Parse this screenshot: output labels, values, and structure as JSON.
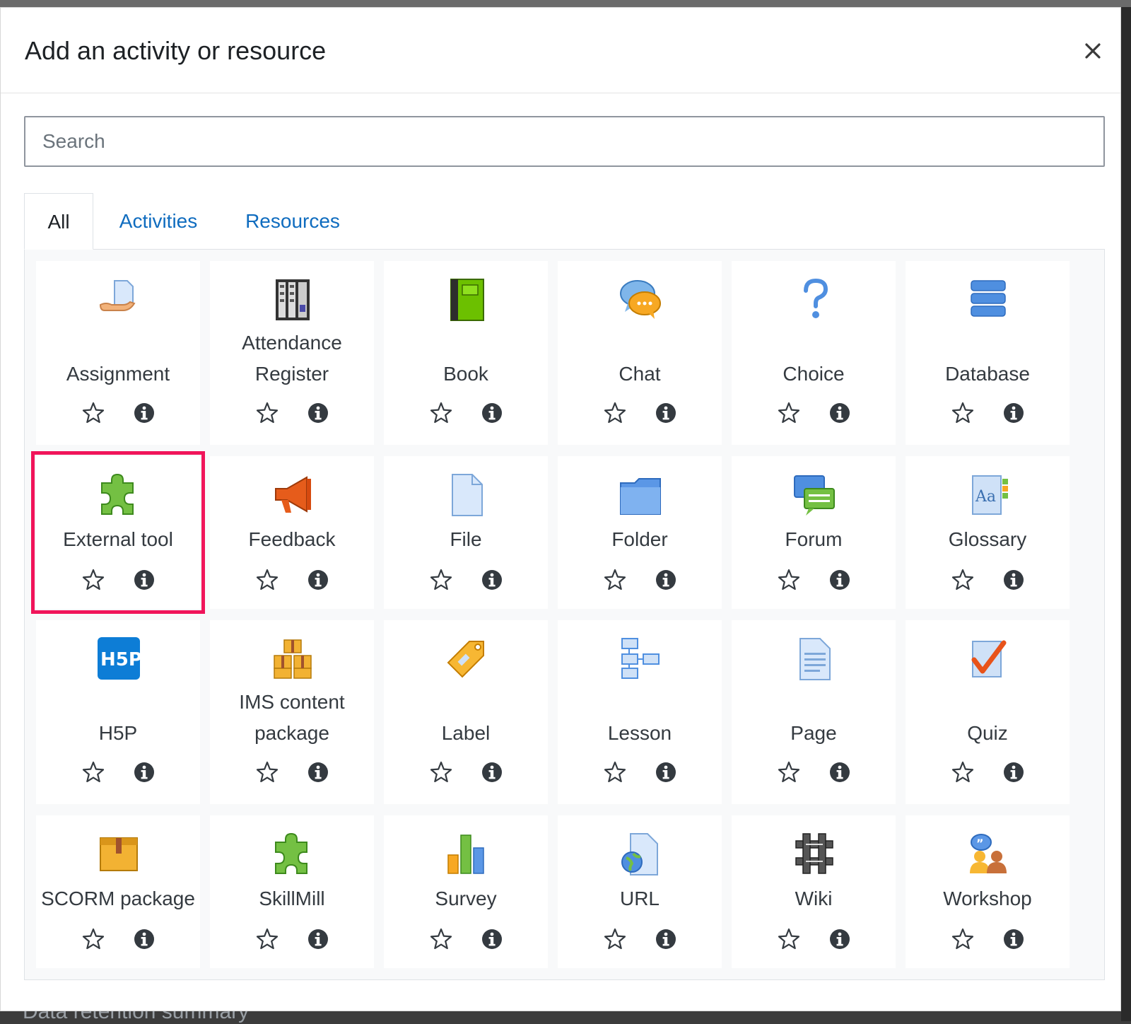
{
  "modal": {
    "title": "Add an activity or resource",
    "close_icon": "close-icon"
  },
  "search": {
    "placeholder": "Search",
    "value": ""
  },
  "tabs": [
    {
      "label": "All",
      "active": true
    },
    {
      "label": "Activities",
      "active": false
    },
    {
      "label": "Resources",
      "active": false
    }
  ],
  "modules": [
    {
      "label": "Assignment",
      "icon": "assignment-icon",
      "starred": false
    },
    {
      "label": "Attendance Register",
      "icon": "attendance-register-icon",
      "starred": false
    },
    {
      "label": "Book",
      "icon": "book-icon",
      "starred": false
    },
    {
      "label": "Chat",
      "icon": "chat-icon",
      "starred": false
    },
    {
      "label": "Choice",
      "icon": "choice-icon",
      "starred": false
    },
    {
      "label": "Database",
      "icon": "database-icon",
      "starred": false
    },
    {
      "label": "External tool",
      "icon": "external-tool-icon",
      "starred": false,
      "highlighted": true
    },
    {
      "label": "Feedback",
      "icon": "feedback-icon",
      "starred": false
    },
    {
      "label": "File",
      "icon": "file-icon",
      "starred": false
    },
    {
      "label": "Folder",
      "icon": "folder-icon",
      "starred": false
    },
    {
      "label": "Forum",
      "icon": "forum-icon",
      "starred": false
    },
    {
      "label": "Glossary",
      "icon": "glossary-icon",
      "starred": false
    },
    {
      "label": "H5P",
      "icon": "h5p-icon",
      "starred": false
    },
    {
      "label": "IMS content package",
      "icon": "ims-content-package-icon",
      "starred": false
    },
    {
      "label": "Label",
      "icon": "label-icon",
      "starred": false
    },
    {
      "label": "Lesson",
      "icon": "lesson-icon",
      "starred": false
    },
    {
      "label": "Page",
      "icon": "page-icon",
      "starred": false
    },
    {
      "label": "Quiz",
      "icon": "quiz-icon",
      "starred": false
    },
    {
      "label": "SCORM package",
      "icon": "scorm-package-icon",
      "starred": false
    },
    {
      "label": "SkillMill",
      "icon": "skillmill-icon",
      "starred": false
    },
    {
      "label": "Survey",
      "icon": "survey-icon",
      "starred": false
    },
    {
      "label": "URL",
      "icon": "url-icon",
      "starred": false
    },
    {
      "label": "Wiki",
      "icon": "wiki-icon",
      "starred": false
    },
    {
      "label": "Workshop",
      "icon": "workshop-icon",
      "starred": false
    }
  ],
  "icons": {
    "star": "star-outline-icon",
    "info": "info-icon"
  },
  "colors": {
    "link": "#0f6cbf",
    "highlight": "#f0145a",
    "text": "#343a40"
  },
  "background_text": "Data retention summary"
}
